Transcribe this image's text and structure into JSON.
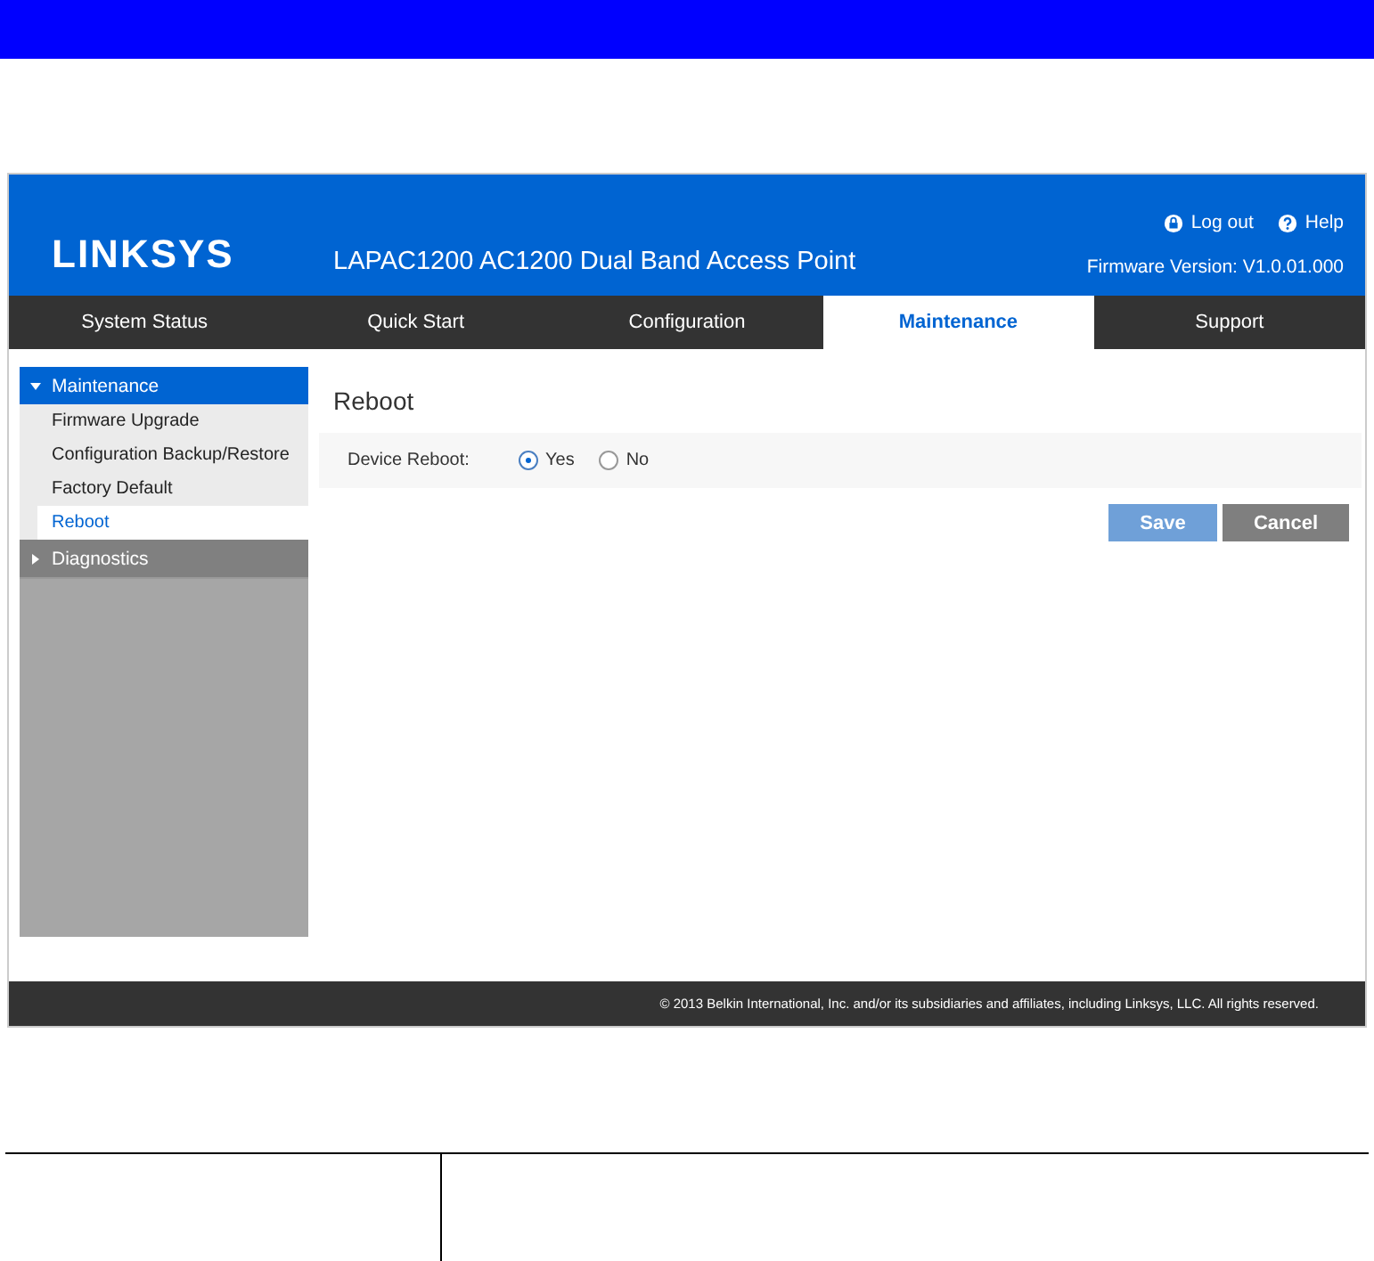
{
  "app": {
    "logo": "LINKSYS",
    "product_title": "LAPAC1200 AC1200 Dual Band Access Point",
    "header_links": [
      {
        "label": "Log out",
        "kind": "logout"
      },
      {
        "label": "Help",
        "kind": "help"
      }
    ],
    "firmware": "Firmware Version: V1.0.01.000",
    "tabs": [
      {
        "label": "System Status",
        "selected": false
      },
      {
        "label": "Quick Start",
        "selected": false
      },
      {
        "label": "Configuration",
        "selected": false
      },
      {
        "label": "Maintenance",
        "selected": true
      },
      {
        "label": "Support",
        "selected": false
      }
    ],
    "sidebar": [
      {
        "label": "Maintenance",
        "expanded": true,
        "children": [
          {
            "label": "Firmware Upgrade",
            "selected": false
          },
          {
            "label": "Configuration Backup/Restore",
            "selected": false
          },
          {
            "label": "Factory Default",
            "selected": false
          },
          {
            "label": "Reboot",
            "selected": true
          }
        ]
      },
      {
        "label": "Diagnostics",
        "expanded": false
      }
    ],
    "page_title": "Reboot",
    "field": {
      "label": "Device Reboot:",
      "options": [
        {
          "label": "Yes",
          "selected": true
        },
        {
          "label": "No",
          "selected": false
        }
      ]
    },
    "buttons": [
      {
        "label": "Save",
        "kind": "primary"
      },
      {
        "label": "Cancel",
        "kind": "secondary"
      }
    ],
    "footer": "© 2013 Belkin International, Inc. and/or its subsidiaries and affiliates, including Linksys, LLC. All rights reserved."
  }
}
